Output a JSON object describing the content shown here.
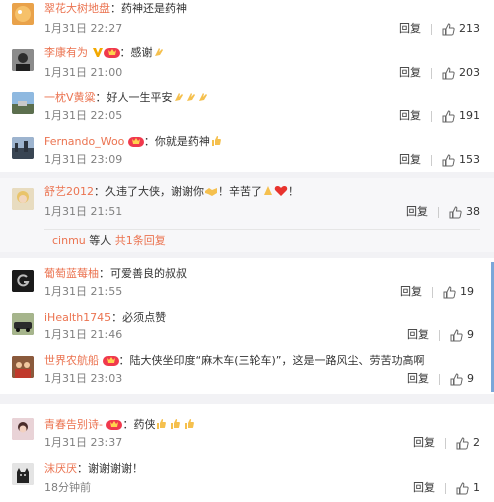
{
  "blocks": [
    {
      "comments": [
        {
          "name": "翠花大树地盘",
          "sep": "：",
          "text": "药神还是药神",
          "time": "1月31日 22:27",
          "reply": "回复",
          "likes": "213",
          "avatar": "orange"
        },
        {
          "name": "李康有为",
          "sep": "：",
          "text": "感谢",
          "time": "1月31日 21:00",
          "reply": "回复",
          "likes": "203",
          "avatar": "portrait"
        },
        {
          "name": "一枕V黄粱",
          "sep": "：",
          "text": "好人一生平安",
          "time": "1月31日 22:05",
          "reply": "回复",
          "likes": "191",
          "avatar": "landscape"
        },
        {
          "name": "Fernando_Woo",
          "sep": "：",
          "text": "你就是药神",
          "time": "1月31日 23:09",
          "reply": "回复",
          "likes": "153",
          "avatar": "city"
        }
      ]
    },
    {
      "comments": [
        {
          "name": "舒艺2012",
          "sep": "：",
          "text": "久违了大侠，谢谢你",
          "text2": "！辛苦了",
          "text3": "！",
          "time": "1月31日 21:51",
          "reply": "回复",
          "likes": "38",
          "avatar": "blonde"
        }
      ],
      "more": {
        "user": "cinmu",
        "mid": " 等人 ",
        "link": "共1条回复"
      }
    },
    {
      "comments": [
        {
          "name": "葡萄蓝莓柚",
          "sep": "：",
          "text": "可爱善良的叔叔",
          "time": "1月31日 21:55",
          "reply": "回复",
          "likes": "19",
          "avatar": "dark"
        },
        {
          "name": "iHealth1745",
          "sep": "：",
          "text": "必须点赞",
          "time": "1月31日 21:46",
          "reply": "回复",
          "likes": "9",
          "avatar": "car"
        },
        {
          "name": "世界农航船",
          "sep": "：",
          "text": "陆大侠坐印度“麻木车(三轮车)”，这是一路风尘、劳苦功高啊",
          "time": "1月31日 23:03",
          "reply": "回复",
          "likes": "9",
          "avatar": "people"
        }
      ]
    },
    {
      "comments": [
        {
          "name": "青春告别诗-",
          "sep": "：",
          "text": "药侠",
          "time": "1月31日 23:37",
          "reply": "回复",
          "likes": "2",
          "avatar": "girl"
        },
        {
          "name": "沫厌厌",
          "sep": "：",
          "text": "谢谢谢谢！",
          "time": "18分钟前",
          "reply": "回复",
          "likes": "1",
          "avatar": "cat"
        }
      ]
    }
  ],
  "colors": {
    "name": "#eb7350",
    "text": "#333333",
    "muted": "#808080",
    "accent": "#7aa7d9"
  },
  "icons": {
    "like": "thumbs-up-icon",
    "vip": "v-badge-icon",
    "member": "crown-badge-icon"
  }
}
